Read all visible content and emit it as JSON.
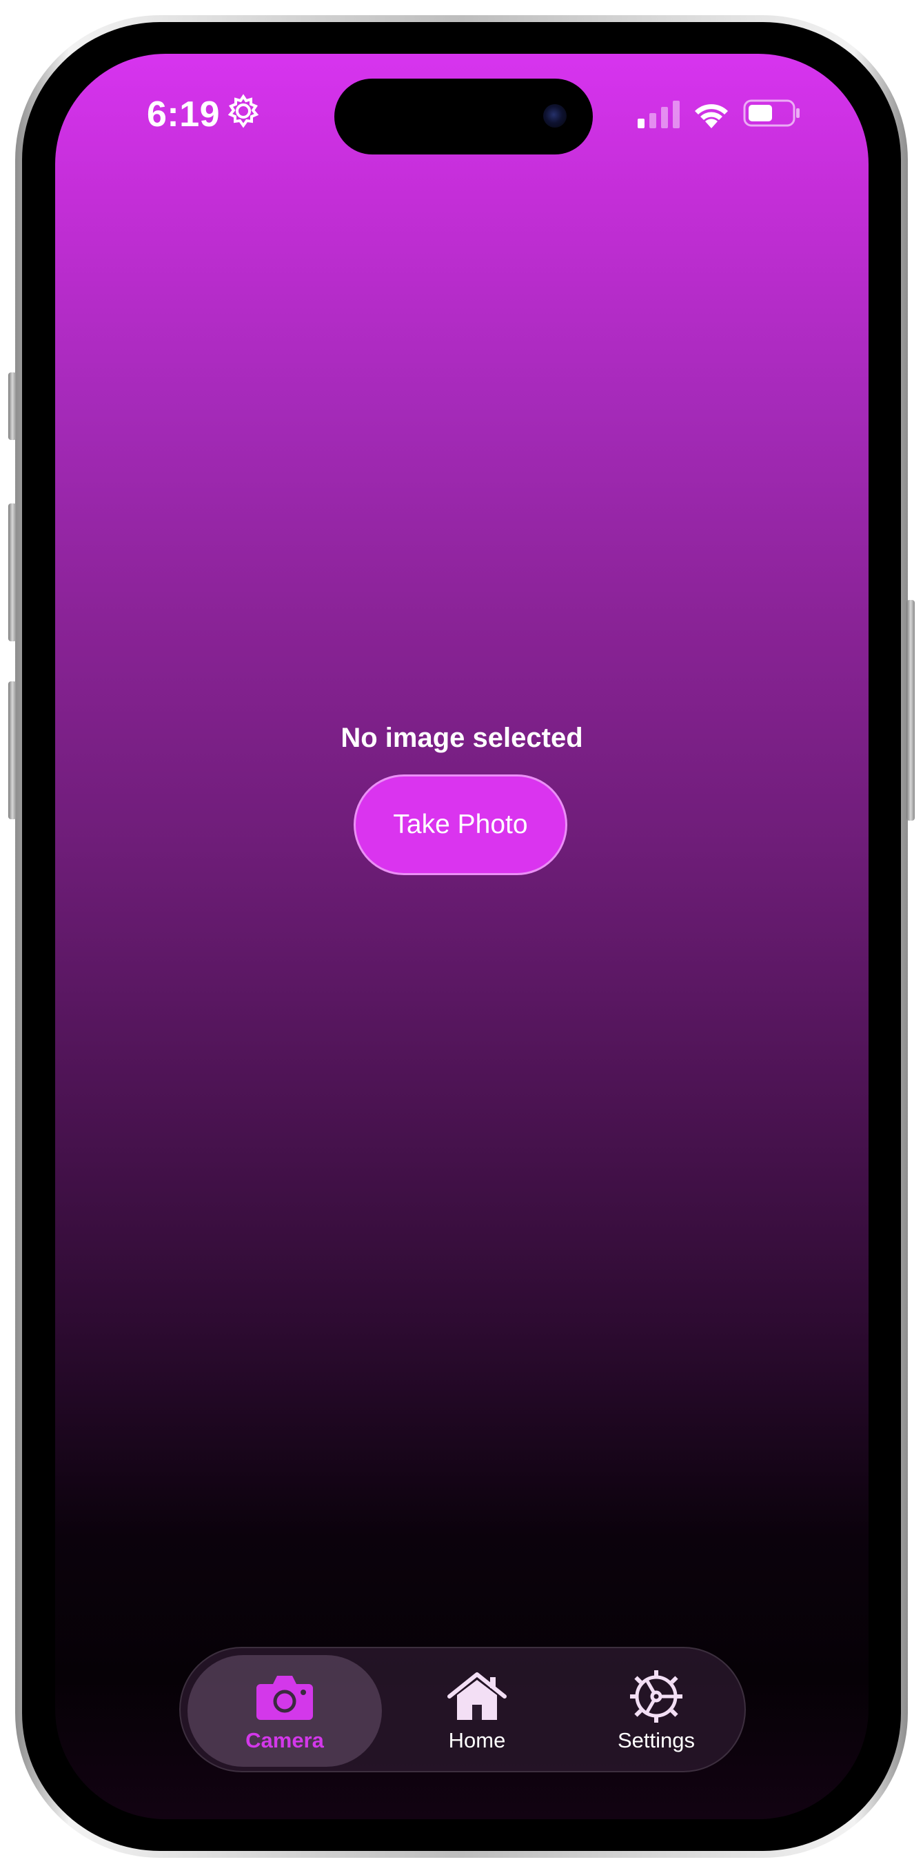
{
  "status_bar": {
    "time": "6:19",
    "gear_icon": "gear-icon",
    "signal_icon": "cellular-signal-icon",
    "wifi_icon": "wifi-icon",
    "battery_icon": "battery-icon"
  },
  "main": {
    "empty_message": "No image selected",
    "take_photo_label": "Take Photo"
  },
  "tab_bar": {
    "tabs": [
      {
        "label": "Camera",
        "icon": "camera-icon",
        "active": true
      },
      {
        "label": "Home",
        "icon": "home-icon",
        "active": false
      },
      {
        "label": "Settings",
        "icon": "settings-gear-icon",
        "active": false
      }
    ]
  },
  "colors": {
    "accent": "#da34ef",
    "gradient_top": "#d734ef",
    "gradient_bottom": "#060106"
  }
}
